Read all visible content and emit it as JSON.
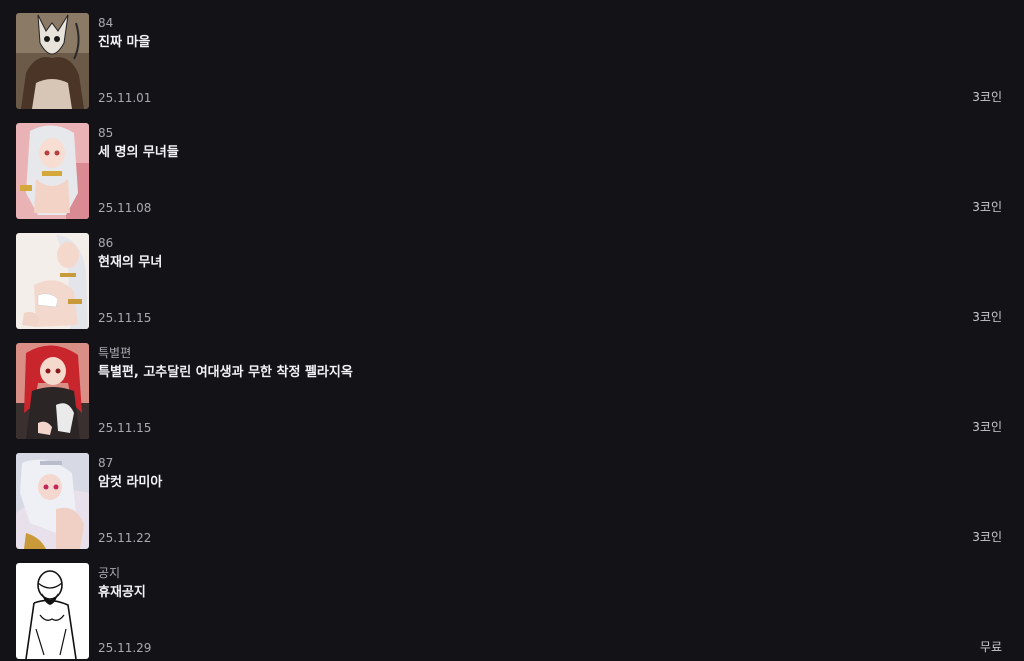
{
  "episodes": [
    {
      "number": "84",
      "title": "진짜 마을",
      "date": "25.11.01",
      "price": "3코인",
      "thumbnail": "skull-mask-creature-thumbnail"
    },
    {
      "number": "85",
      "title": "세 명의 무녀들",
      "date": "25.11.08",
      "price": "3코인",
      "thumbnail": "white-haired-shrine-maiden-thumbnail"
    },
    {
      "number": "86",
      "title": "현재의 무녀",
      "date": "25.11.15",
      "price": "3코인",
      "thumbnail": "white-haired-maiden-sitting-thumbnail"
    },
    {
      "number": "특별편",
      "title": "특별편, 고추달린 여대생과 무한 착정 펠라지옥",
      "date": "25.11.15",
      "price": "3코인",
      "thumbnail": "red-haired-woman-thumbnail"
    },
    {
      "number": "87",
      "title": "암컷 라미아",
      "date": "25.11.22",
      "price": "3코인",
      "thumbnail": "white-haired-lamia-thumbnail"
    },
    {
      "number": "공지",
      "title": "휴재공지",
      "date": "25.11.29",
      "price": "무료",
      "thumbnail": "bowing-man-sketch-thumbnail"
    }
  ]
}
